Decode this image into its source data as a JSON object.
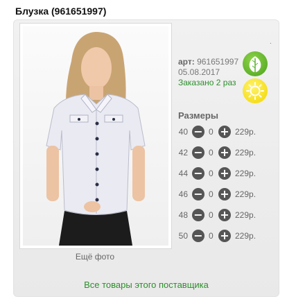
{
  "product": {
    "title": "Блузка (961651997)",
    "dot": ".",
    "art_label": "арт:",
    "art_value": "961651997",
    "date": "05.08.2017",
    "ordered": "Заказано 2 раз",
    "more_photo": "Ещё фото",
    "sizes_title": "Размеры",
    "supplier_link": "Все товары этого поставщика"
  },
  "icons": {
    "leaf": "leaf-icon",
    "sun": "sun-icon",
    "minus": "minus-icon",
    "plus": "plus-icon"
  },
  "colors": {
    "accent_green": "#2b8f2b",
    "leaf": "#5ab32a",
    "sun": "#f5dc00"
  },
  "sizes": [
    {
      "size": "40",
      "qty": "0",
      "price": "229р."
    },
    {
      "size": "42",
      "qty": "0",
      "price": "229р."
    },
    {
      "size": "44",
      "qty": "0",
      "price": "229р."
    },
    {
      "size": "46",
      "qty": "0",
      "price": "229р."
    },
    {
      "size": "48",
      "qty": "0",
      "price": "229р."
    },
    {
      "size": "50",
      "qty": "0",
      "price": "229р."
    }
  ]
}
